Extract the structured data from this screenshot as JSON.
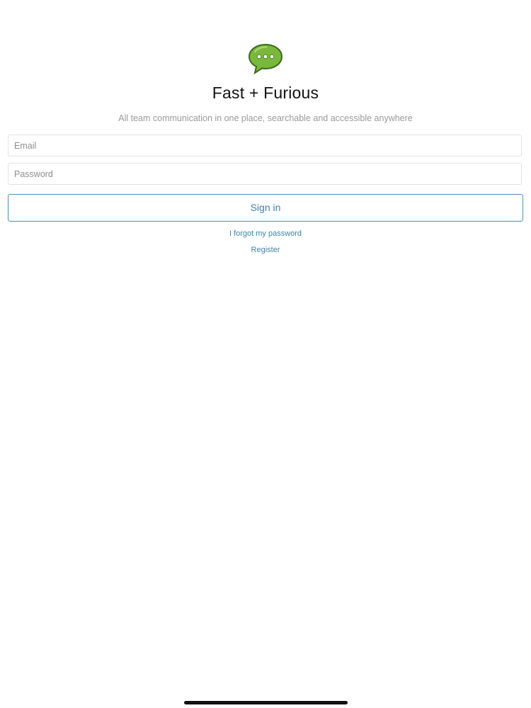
{
  "app": {
    "title": "Fast + Furious",
    "tagline": "All team communication in one place, searchable and accessible anywhere",
    "logo_icon": "speech-bubble-icon",
    "accent_color": "#3e83a8",
    "logo_color": "#7ab83b"
  },
  "form": {
    "email_placeholder": "Email",
    "email_value": "",
    "password_placeholder": "Password",
    "password_value": "",
    "signin_label": "Sign in"
  },
  "links": {
    "forgot_password": "I forgot my password",
    "register": "Register"
  }
}
